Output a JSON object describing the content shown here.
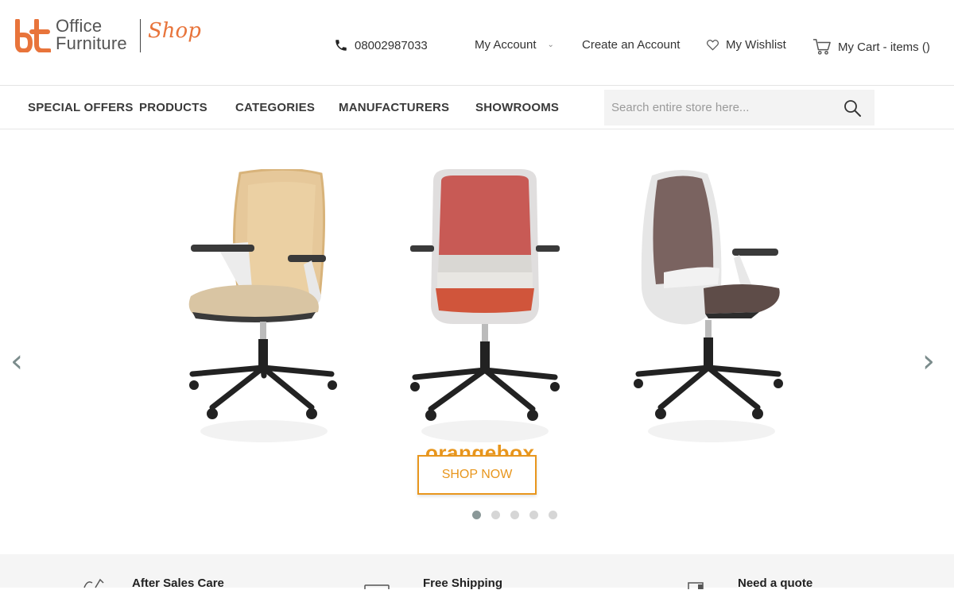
{
  "header": {
    "logo_line1": "Office",
    "logo_line2": "Furniture",
    "logo_shop": "Shop",
    "phone": "08002987033",
    "my_account": "My Account",
    "create_account": "Create an Account",
    "wishlist": "My Wishlist",
    "cart": "My Cart - items ()"
  },
  "nav": {
    "items": [
      "SPECIAL OFFERS",
      "PRODUCTS",
      "CATEGORIES",
      "MANUFACTURERS",
      "SHOWROOMS"
    ],
    "search_placeholder": "Search entire store here..."
  },
  "slider": {
    "brand": "orangebox",
    "cta": "SHOP NOW",
    "dots": 5,
    "active_dot": 1,
    "prev": "‹",
    "next": "›"
  },
  "features": {
    "items": [
      "After Sales Care",
      "Free Shipping",
      "Need a quote"
    ]
  },
  "colors": {
    "accent": "#e8743b",
    "cta": "#e8961d",
    "arrow": "#7b8c8c"
  }
}
